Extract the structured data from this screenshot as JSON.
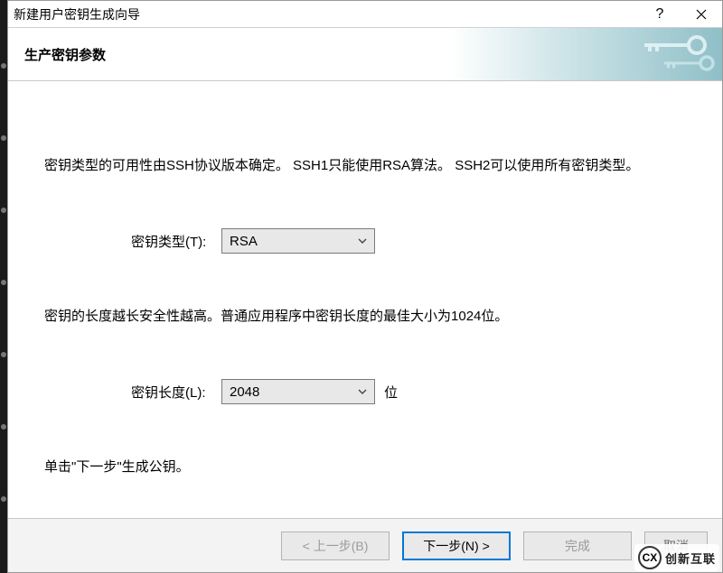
{
  "window": {
    "title": "新建用户密钥生成向导"
  },
  "banner": {
    "heading": "生产密钥参数"
  },
  "content": {
    "desc1": "密钥类型的可用性由SSH协议版本确定。 SSH1只能使用RSA算法。 SSH2可以使用所有密钥类型。",
    "key_type_label": "密钥类型(T):",
    "key_type_value": "RSA",
    "desc2": "密钥的长度越长安全性越高。普通应用程序中密钥长度的最佳大小为1024位。",
    "key_length_label": "密钥长度(L):",
    "key_length_value": "2048",
    "key_length_unit": "位",
    "hint": "单击\"下一步\"生成公钥。"
  },
  "footer": {
    "back": "< 上一步(B)",
    "next": "下一步(N) >",
    "finish": "完成",
    "cancel": "取消"
  },
  "watermark": {
    "badge": "CX",
    "text": "创新互联"
  }
}
